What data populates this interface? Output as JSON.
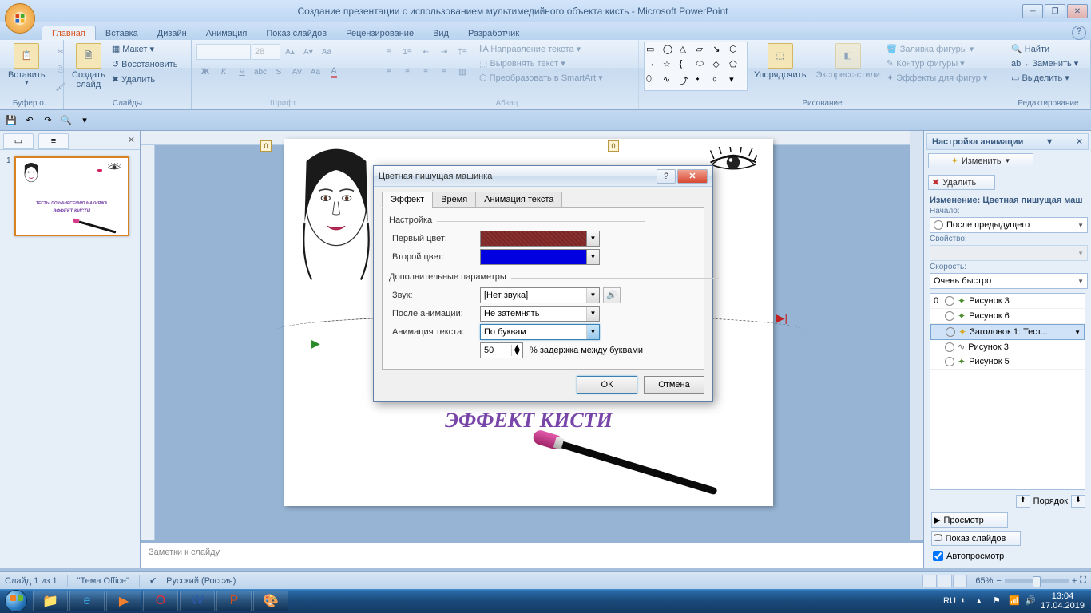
{
  "titlebar": {
    "title": "Создание презентации с использованием мультимедийного объекта кисть - Microsoft PowerPoint"
  },
  "ribbon": {
    "tabs": [
      "Главная",
      "Вставка",
      "Дизайн",
      "Анимация",
      "Показ слайдов",
      "Рецензирование",
      "Вид",
      "Разработчик"
    ],
    "groups": {
      "clipboard": {
        "label": "Буфер о...",
        "paste": "Вставить"
      },
      "slides": {
        "label": "Слайды",
        "new": "Создать\nслайд",
        "layout": "Макет",
        "reset": "Восстановить",
        "delete": "Удалить"
      },
      "font": {
        "label": "Шрифт",
        "size": "28"
      },
      "paragraph": {
        "label": "Абзац",
        "dir": "Направление текста",
        "align": "Выровнять текст",
        "smartart": "Преобразовать в SmartArt"
      },
      "drawing": {
        "label": "Рисование",
        "arrange": "Упорядочить",
        "styles": "Экспресс-стили",
        "fill": "Заливка фигуры",
        "outline": "Контур фигуры",
        "effects": "Эффекты для фигур"
      },
      "editing": {
        "label": "Редактирование",
        "find": "Найти",
        "replace": "Заменить",
        "select": "Выделить"
      }
    }
  },
  "slide": {
    "markers": [
      "0",
      "0",
      "0"
    ],
    "txt1": "ТЕ                                       А",
    "txt2": "ЭФФЕКТ КИСТИ",
    "thumb_txt1": "ТЕСТЫ ПО НАНЕСЕНИЮ МАКИЯЖА",
    "thumb_txt2": "ЭФФЕКТ КИСТИ",
    "notes": "Заметки к слайду",
    "num": "1"
  },
  "anim_pane": {
    "title": "Настройка анимации",
    "change": "Изменить",
    "delete": "Удалить",
    "modify": "Изменение: Цветная пишущая маш",
    "start_label": "Начало:",
    "start_value": "После предыдущего",
    "prop_label": "Свойство:",
    "speed_label": "Скорость:",
    "speed_value": "Очень быстро",
    "items": [
      {
        "num": "0",
        "txt": "Рисунок 3"
      },
      {
        "num": "",
        "txt": "Рисунок 6"
      },
      {
        "num": "",
        "txt": "Заголовок 1: Тест..."
      },
      {
        "num": "",
        "txt": "Рисунок 3"
      },
      {
        "num": "",
        "txt": "Рисунок 5"
      }
    ],
    "reorder": "Порядок",
    "preview": "Просмотр",
    "slideshow": "Показ слайдов",
    "autopreview": "Автопросмотр"
  },
  "dialog": {
    "title": "Цветная пишущая машинка",
    "tabs": [
      "Эффект",
      "Время",
      "Анимация текста"
    ],
    "settings_label": "Настройка",
    "first_color": "Первый цвет:",
    "first_color_val": "#8b2f2f",
    "second_color": "Второй цвет:",
    "second_color_val": "#0000e0",
    "extra_label": "Дополнительные параметры",
    "sound": "Звук:",
    "sound_val": "[Нет звука]",
    "after": "После анимации:",
    "after_val": "Не затемнять",
    "text_anim": "Анимация текста:",
    "text_anim_val": "По буквам",
    "delay_val": "50",
    "delay_label": "% задержка между буквами",
    "ok": "ОК",
    "cancel": "Отмена"
  },
  "statusbar": {
    "slide": "Слайд 1 из 1",
    "theme": "\"Тема Office\"",
    "lang": "Русский (Россия)",
    "zoom": "65%"
  },
  "taskbar": {
    "lang": "RU",
    "time": "13:04",
    "date": "17.04.2019"
  }
}
